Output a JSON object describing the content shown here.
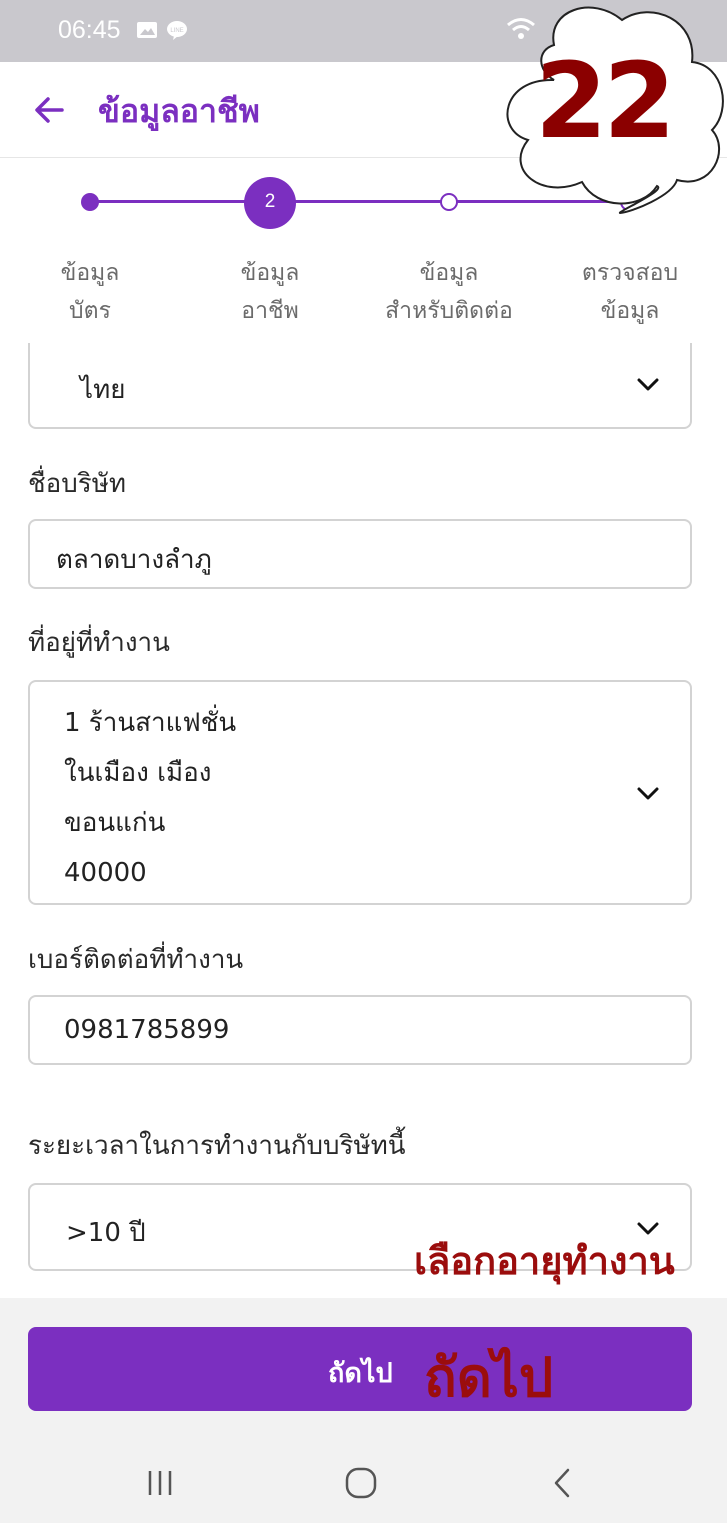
{
  "status_bar": {
    "time": "06:45"
  },
  "header": {
    "title": "ข้อมูลอาชีพ"
  },
  "stepper": {
    "current_step": "2",
    "steps": [
      {
        "line1": "ข้อมูล",
        "line2": "บัตร"
      },
      {
        "line1": "ข้อมูล",
        "line2": "อาชีพ"
      },
      {
        "line1": "ข้อมูล",
        "line2": "สำหรับติดต่อ"
      },
      {
        "line1": "ตรวจสอบ",
        "line2": "ข้อมูล"
      }
    ]
  },
  "form": {
    "nationality_value": "ไทย",
    "company_label": "ชื่อบริษัท",
    "company_value": "ตลาดบางลำภู",
    "workplace_label": "ที่อยู่ที่ทำงาน",
    "workplace_lines": [
      "1 ร้านสาแฟชั่น",
      "ในเมือง เมือง",
      "ขอนแก่น",
      "40000"
    ],
    "phone_label": "เบอร์ติดต่อที่ทำงาน",
    "phone_value": "0981785899",
    "duration_label": "ระยะเวลาในการทำงานกับบริษัทนี้",
    "duration_value": ">10 ปี"
  },
  "next_button": {
    "label": "ถัดไป"
  },
  "annotations": {
    "step_number": "22",
    "select_duration_note": "เลือกอายุทำงาน",
    "next_note": "ถัดไป"
  },
  "colors": {
    "accent": "#7b2fc0",
    "annotation": "#9b0d0d",
    "status_bar": "#c9c8cd"
  },
  "icons": [
    "image-icon",
    "line-chat-icon",
    "wifi-icon",
    "back-arrow-icon",
    "chevron-down-icon",
    "recent-apps-icon",
    "home-icon",
    "back-nav-icon"
  ]
}
